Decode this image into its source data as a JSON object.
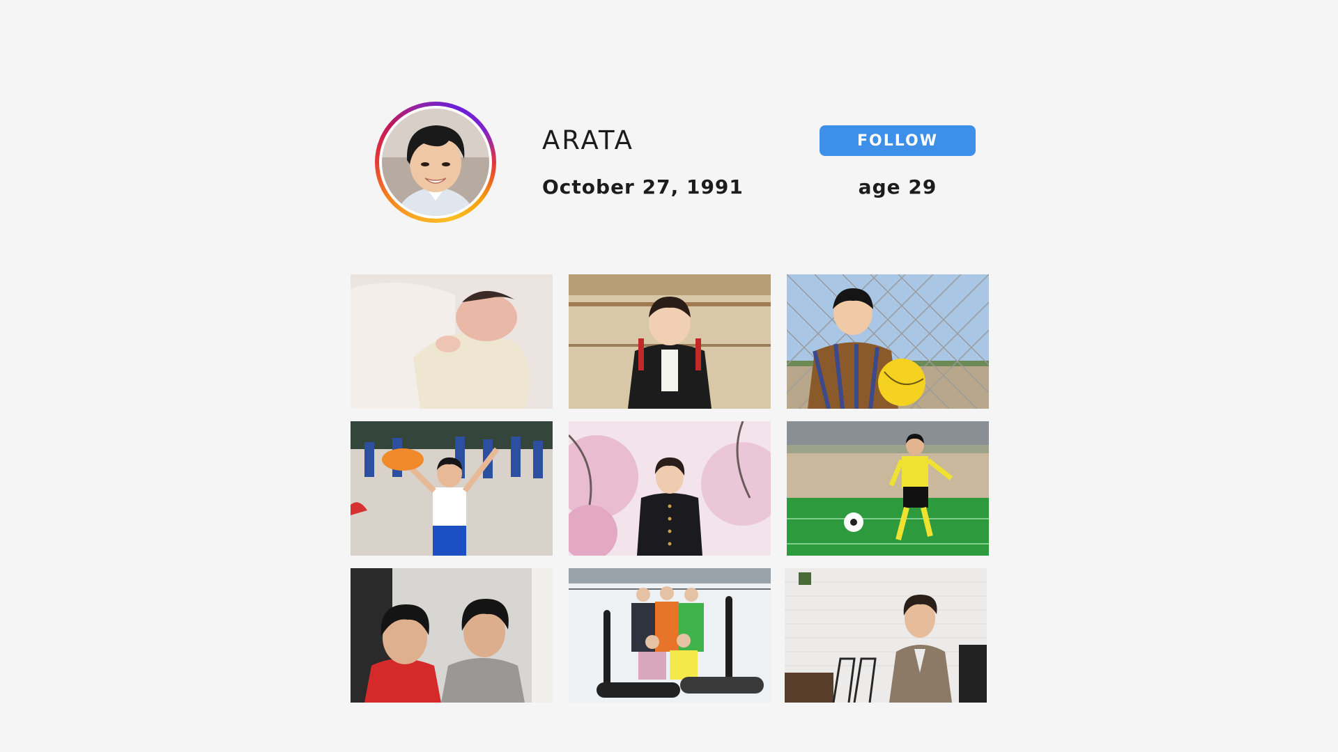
{
  "profile": {
    "username": "ARATA",
    "birthdate": "October 27, 1991",
    "age": "age 29",
    "follow_label": "FOLLOW"
  },
  "photos": [
    {
      "icon": "newborn-baby-photo"
    },
    {
      "icon": "toddler-kimono-photo"
    },
    {
      "icon": "boy-with-ball-photo"
    },
    {
      "icon": "sports-day-photo"
    },
    {
      "icon": "cherry-blossom-school-photo"
    },
    {
      "icon": "soccer-player-photo"
    },
    {
      "icon": "teen-boys-photo"
    },
    {
      "icon": "snowboard-group-photo"
    },
    {
      "icon": "adult-in-cafe-photo"
    }
  ],
  "colors": {
    "background": "#f5f5f5",
    "accent": "#3d8fe8",
    "text": "#1c1c1c"
  }
}
